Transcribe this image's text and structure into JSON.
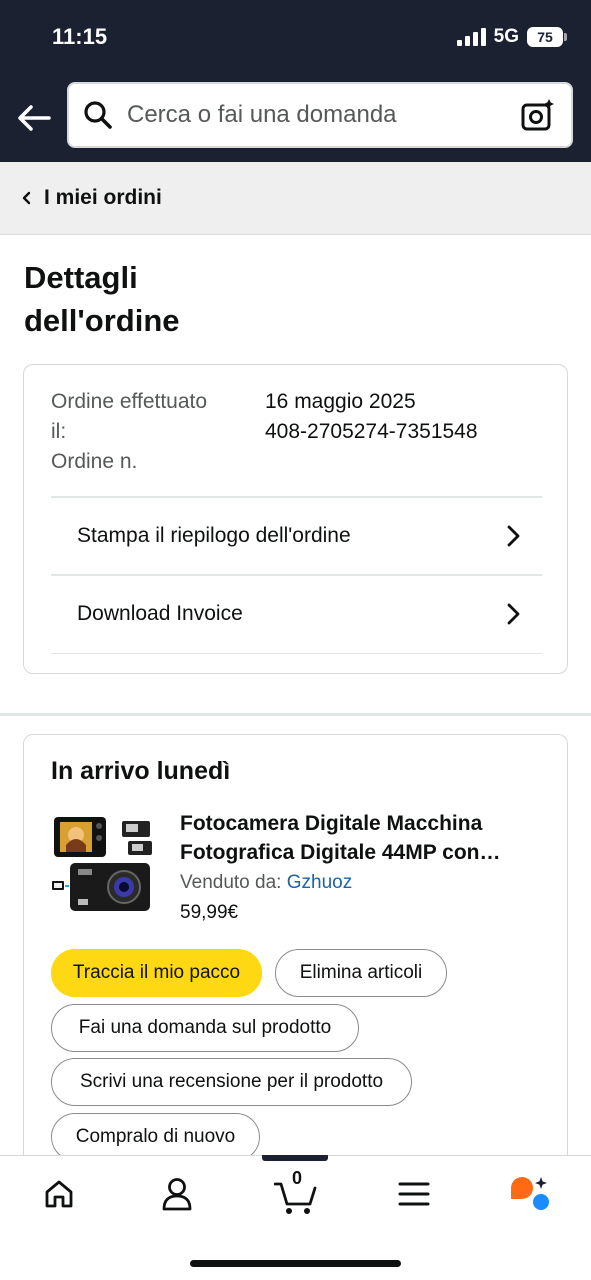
{
  "status_bar": {
    "time": "11:15",
    "network": "5G",
    "battery": "75"
  },
  "search": {
    "placeholder": "Cerca o fai una domanda"
  },
  "breadcrumb": {
    "label": "I miei ordini"
  },
  "page": {
    "title_line1": "Dettagli",
    "title_line2": "dell'ordine"
  },
  "order": {
    "placed_label_line1": "Ordine effettuato",
    "placed_label_line2": "il:",
    "number_label": "Ordine n.",
    "date": "16 maggio 2025",
    "number": "408-2705274-7351548",
    "links": [
      {
        "label": "Stampa il riepilogo dell'ordine"
      },
      {
        "label": "Download Invoice"
      }
    ]
  },
  "shipment": {
    "title": "In arrivo lunedì",
    "product": {
      "title_line1": "Fotocamera Digitale Macchina",
      "title_line2": "Fotografica Digitale 44MP con…",
      "seller_label": "Venduto da:",
      "seller_name": "Gzhuoz",
      "price": "59,99€"
    },
    "actions": [
      {
        "label": "Traccia il mio pacco"
      },
      {
        "label": "Elimina articoli"
      },
      {
        "label": "Fai una domanda sul prodotto"
      },
      {
        "label": "Scrivi una recensione per il prodotto"
      },
      {
        "label": "Compralo di nuovo"
      }
    ]
  },
  "bottom_nav": {
    "cart_count": "0",
    "items": [
      "home-icon",
      "account-icon",
      "cart-icon",
      "menu-icon",
      "rufus-icon"
    ]
  },
  "colors": {
    "header_bg": "#1b2130",
    "primary_button": "#ffd814",
    "link": "#2162a1",
    "rufus_orange": "#ff6a13",
    "rufus_blue": "#1a8cff"
  }
}
